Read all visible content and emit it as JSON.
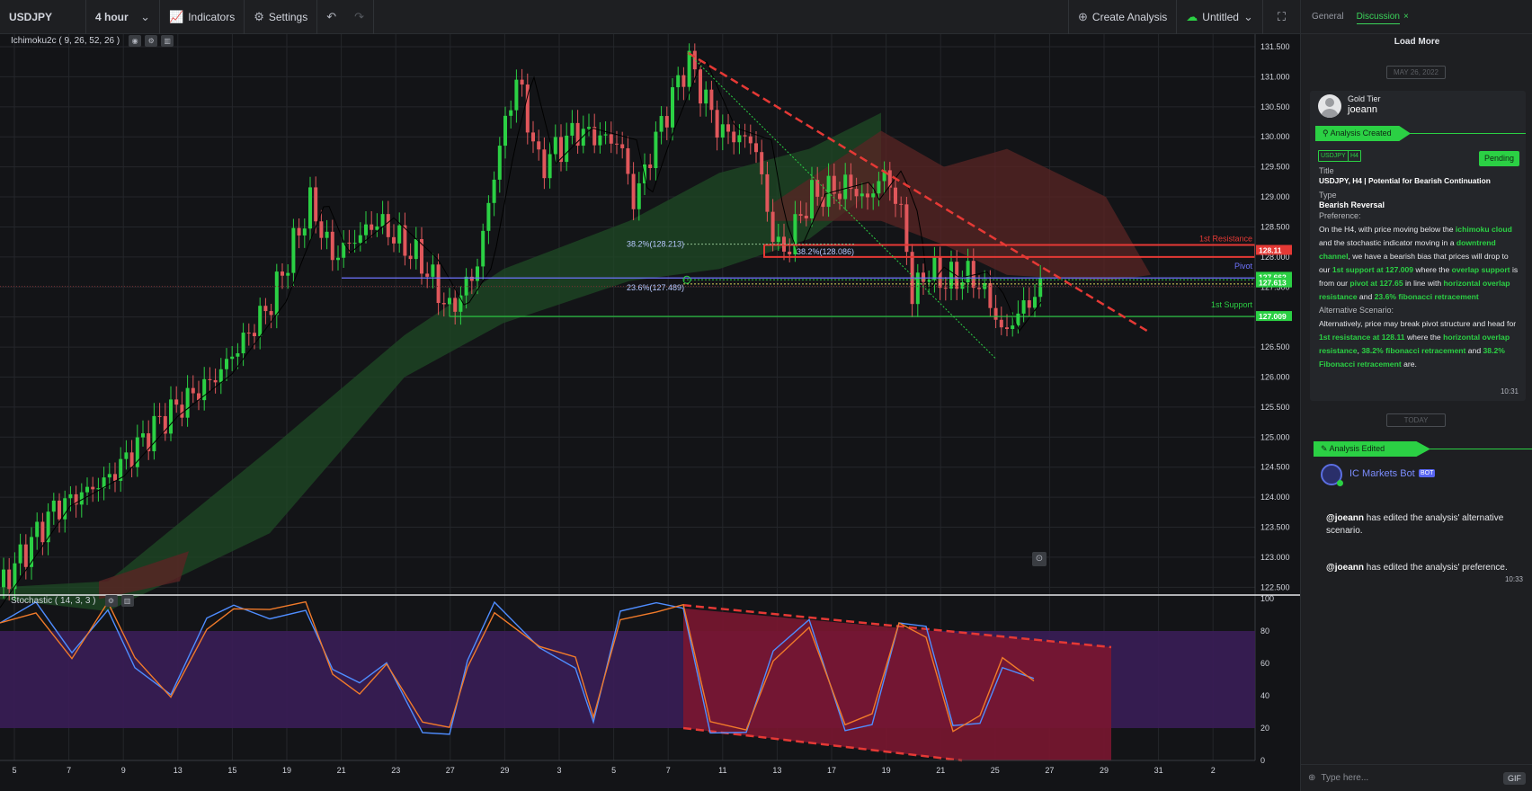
{
  "toolbar": {
    "symbol": "USDJPY",
    "interval": "4 hour",
    "indicators_label": "Indicators",
    "settings_label": "Settings",
    "create_analysis_label": "Create Analysis",
    "layout_name": "Untitled"
  },
  "chart": {
    "indicator_main": "Ichimoku2c ( 9, 26, 52, 26 )",
    "indicator_sub": "Stochastic ( 14, 3, 3 )",
    "price_ticks": [
      "131.500",
      "131.000",
      "130.500",
      "130.000",
      "129.500",
      "129.000",
      "128.500",
      "128.000",
      "127.500",
      "127.000",
      "126.500",
      "126.000",
      "125.500",
      "125.000",
      "124.500",
      "124.000",
      "123.500",
      "123.000",
      "122.500"
    ],
    "price_range": [
      122.4,
      131.65
    ],
    "stoch_ticks": [
      "100",
      "80",
      "60",
      "40",
      "20",
      "0"
    ],
    "date_labels": [
      "5",
      "7",
      "9",
      "13",
      "15",
      "19",
      "21",
      "23",
      "27",
      "29",
      "3",
      "5",
      "7",
      "11",
      "13",
      "17",
      "19",
      "21",
      "25",
      "27",
      "29",
      "31",
      "2"
    ],
    "price_markers": [
      {
        "label": "128.11",
        "price": 128.11,
        "color": "#e53935"
      },
      {
        "label": "127.662",
        "price": 127.662,
        "color": "#2bd044"
      },
      {
        "label": "127.613",
        "price": 127.613,
        "color": "#2bd044"
      },
      {
        "label": "127.009",
        "price": 127.009,
        "color": "#2bd044"
      }
    ],
    "level_labels": {
      "resistance": "1st Resistance",
      "pivot": "Pivot",
      "support": "1st Support",
      "fib_382_a": "38.2%(128.213)",
      "fib_382_b": "38.2%(128.086)",
      "fib_236": "23.6%(127.489)"
    }
  },
  "sidebar": {
    "tab_general": "General",
    "tab_discussion": "Discussion",
    "load_more": "Load More",
    "date_first": "MAY 26, 2022",
    "date_today": "TODAY",
    "card": {
      "tier": "Gold Tier",
      "user": "joeann",
      "ribbon": "Analysis Created",
      "tag_symbol": "USDJPY",
      "tag_tf": "H4",
      "status": "Pending",
      "title_label": "Title",
      "title": "USDJPY, H4 | Potential for Bearish Continuation",
      "type_label": "Type",
      "type": "Bearish Reversal",
      "preference_label": "Preference:",
      "alt_label": "Alternative Scenario:",
      "time": "10:31"
    },
    "edited_ribbon": "Analysis Edited",
    "bot_name": "IC Markets Bot",
    "bot_tag": "BOT",
    "msg1_user": "@joeann",
    "msg1_text": " has edited the analysis' alternative scenario.",
    "msg2_user": "@joeann",
    "msg2_text": " has edited the analysis' preference.",
    "msg2_time": "10:33",
    "compose_placeholder": "Type here...",
    "gif_label": "GIF"
  }
}
